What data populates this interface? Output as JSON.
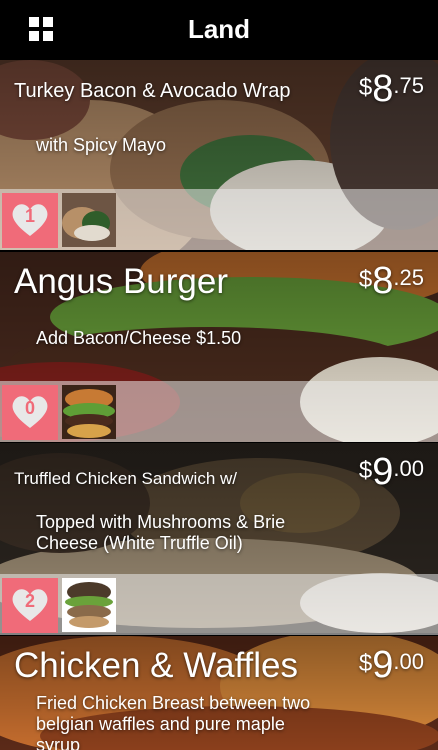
{
  "header": {
    "title": "Land",
    "menu_icon": "grid-menu-icon"
  },
  "items": [
    {
      "name": "Turkey Bacon & Avocado Wrap",
      "price_currency": "$",
      "price_whole": "8",
      "price_cents": ".75",
      "description": "with Spicy Mayo",
      "likes": "1"
    },
    {
      "name": "Angus Burger",
      "price_currency": "$",
      "price_whole": "8",
      "price_cents": ".25",
      "description": "Add Bacon/Cheese $1.50",
      "likes": "0"
    },
    {
      "name": "Truffled Chicken Sandwich w/",
      "price_currency": "$",
      "price_whole": "9",
      "price_cents": ".00",
      "description": "Topped with Mushrooms & Brie Cheese (White Truffle Oil)",
      "likes": "2"
    },
    {
      "name": "Chicken & Waffles",
      "price_currency": "$",
      "price_whole": "9",
      "price_cents": ".00",
      "description": "Fried Chicken Breast between two belgian waffles and pure maple syrup"
    }
  ],
  "colors": {
    "accent": "#f06b79",
    "header_bg": "#000000"
  }
}
